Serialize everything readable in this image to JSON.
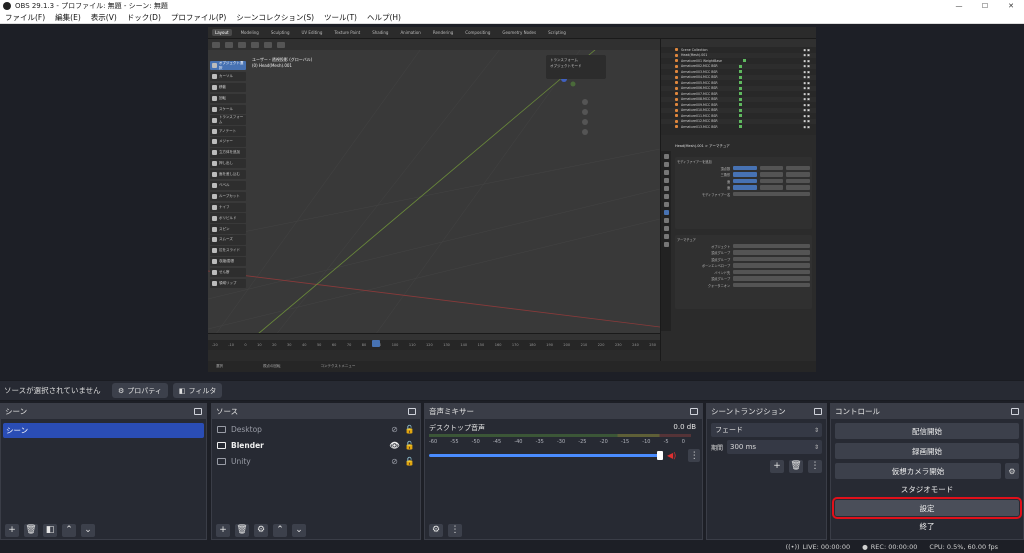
{
  "window": {
    "title": "OBS 29.1.3 - プロファイル: 無題 - シーン: 無題",
    "minimize": "—",
    "maximize": "☐",
    "close": "✕"
  },
  "menu": [
    "ファイル(F)",
    "編集(E)",
    "表示(V)",
    "ドック(D)",
    "プロファイル(P)",
    "シーンコレクション(S)",
    "ツール(T)",
    "ヘルプ(H)"
  ],
  "preview": {
    "blender": {
      "workspace_tabs": [
        "Layout",
        "Modeling",
        "Sculpting",
        "UV Editing",
        "Texture Paint",
        "Shading",
        "Animation",
        "Rendering",
        "Compositing",
        "Geometry Nodes",
        "Scripting"
      ],
      "active_tab": "Layout",
      "viewport_info": [
        "ユーザー・透視投影 (グローバル)",
        "(0) Head(Mesh).001"
      ],
      "tools": [
        "オブジェクト選択",
        "カーソル",
        "移動",
        "回転",
        "スケール",
        "トランスフォーム",
        "アノテート",
        "メジャー",
        "立方体を追加",
        "押し出し",
        "面を差し込む",
        "ベベル",
        "ループカット",
        "ナイフ",
        "ポリビルド",
        "スピン",
        "スムーズ",
        "辺をスライド",
        "収縮/膨張",
        "せん断",
        "領域リップ"
      ],
      "gizmo_panel": [
        "トランスフォーム",
        "オブジェクトモード"
      ],
      "outliner_rows": [
        "Scene Collection",
        "Head(Mesh).001",
        "Armature001 WeightBase",
        "Armature002.MCC BSR",
        "Armature003.MCC BSR",
        "Armature004.MCC BSR",
        "Armature005.MCC BSR",
        "Armature006.MCC BSR",
        "Armature007.MCC BSR",
        "Armature008.MCC BSR",
        "Armature009.MCC BSR",
        "Armature010.MCC BSR",
        "Armature011.MCC BSR",
        "Armature012.MCC BSR",
        "Armature013.MCC BSR"
      ],
      "properties": {
        "header": "Head(Mesh).001 > アーマチュア",
        "section": "モディファイアーを追加",
        "rows1": [
          "頂点数",
          "三角形",
          "面",
          "面"
        ],
        "row_modifier": "モディファイアー名",
        "row_armature": "アーマチュア",
        "rows2": [
          "オブジェクト",
          "頂点グループ",
          "頂点グループ",
          "ボーンエンベロープ",
          "バインド先",
          "頂点グループ",
          "クォータニオン"
        ]
      },
      "timeline_ticks": [
        "-20",
        "-10",
        "0",
        "10",
        "20",
        "30",
        "40",
        "50",
        "60",
        "70",
        "80",
        "90",
        "100",
        "110",
        "120",
        "130",
        "140",
        "150",
        "160",
        "170",
        "180",
        "190",
        "200",
        "210",
        "220",
        "230",
        "240",
        "250"
      ],
      "status": [
        "選択",
        "視点の回転",
        "コンテクストメニュー"
      ]
    }
  },
  "source_bar": {
    "no_source": "ソースが選択されていません",
    "properties": "プロパティ",
    "filters": "フィルタ"
  },
  "docks": {
    "scenes": {
      "title": "シーン",
      "items": [
        "シーン"
      ]
    },
    "sources": {
      "title": "ソース",
      "items": [
        {
          "name": "Desktop",
          "visible": false
        },
        {
          "name": "Blender",
          "visible": true
        },
        {
          "name": "Unity",
          "visible": false
        }
      ]
    },
    "mixer": {
      "title": "音声ミキサー",
      "track": "デスクトップ音声",
      "level": "0.0 dB",
      "scale": [
        "-60",
        "-55",
        "-50",
        "-45",
        "-40",
        "-35",
        "-30",
        "-25",
        "-20",
        "-15",
        "-10",
        "-5",
        "0"
      ],
      "fader_fraction": 1.0
    },
    "transitions": {
      "title": "シーントランジション",
      "selected": "フェード",
      "duration_label": "期間",
      "duration": "300 ms"
    },
    "controls": {
      "title": "コントロール",
      "stream": "配信開始",
      "record": "録画開始",
      "vcam": "仮想カメラ開始",
      "studio": "スタジオモード",
      "settings": "設定",
      "exit": "終了"
    }
  },
  "statusbar": {
    "live": "LIVE: 00:00:00",
    "rec": "REC: 00:00:00",
    "cpu": "CPU: 0.5%, 60.00 fps"
  },
  "colors": {
    "accent": "#2a4db5",
    "highlight": "#e0101a",
    "panel": "#272a33"
  }
}
